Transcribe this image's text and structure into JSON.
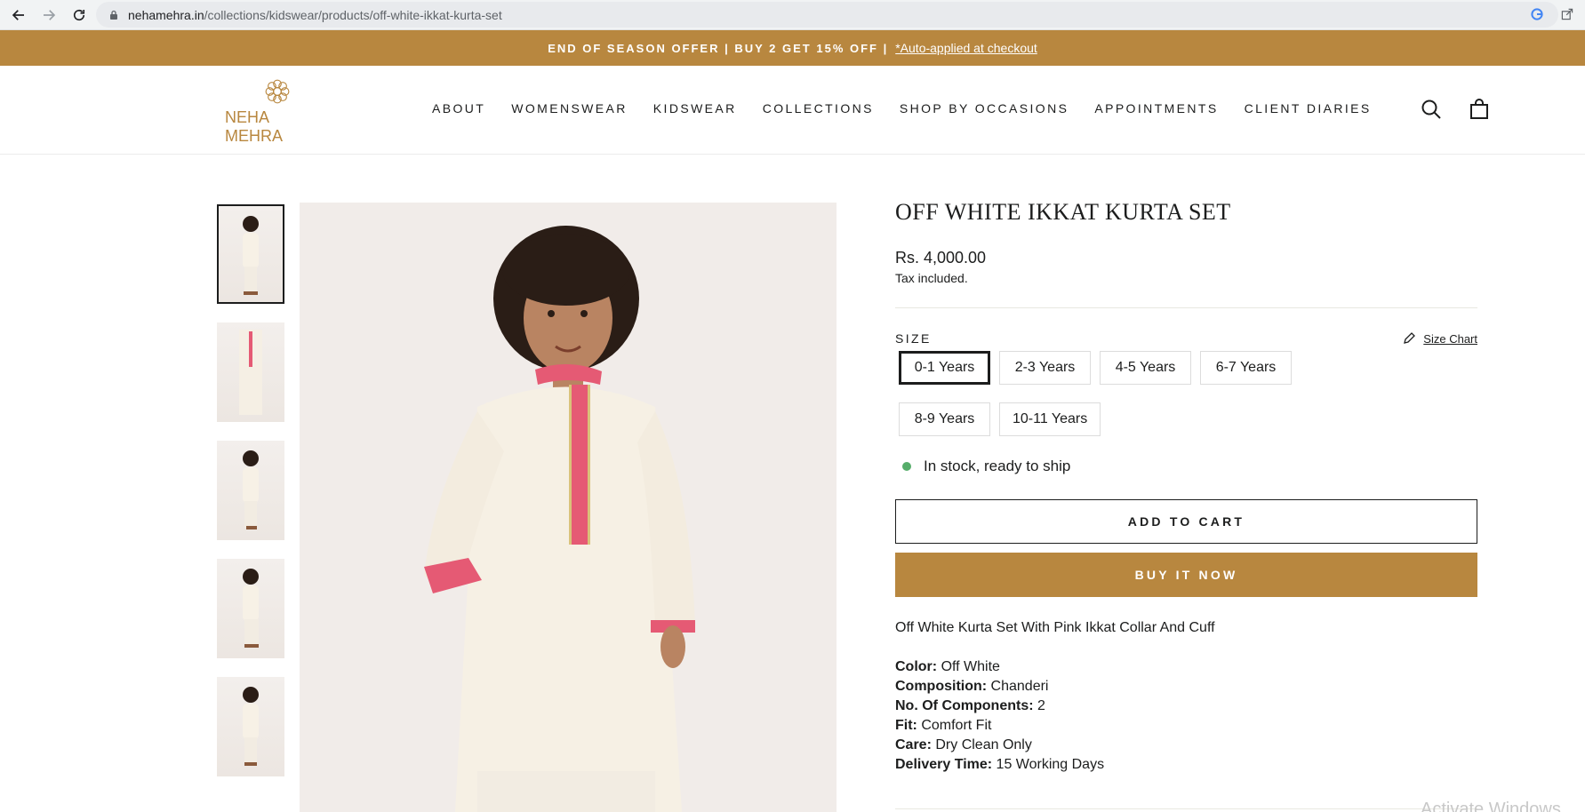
{
  "browser": {
    "url_domain": "nehamehra.in",
    "url_path": "/collections/kidswear/products/off-white-ikkat-kurta-set"
  },
  "announcement": {
    "text": "END OF SEASON OFFER | BUY 2 GET 15% OFF |",
    "link": "*Auto-applied at checkout"
  },
  "logo": {
    "text": "NEHA MEHRA"
  },
  "nav": {
    "items": [
      "ABOUT",
      "WOMENSWEAR",
      "KIDSWEAR",
      "COLLECTIONS",
      "SHOP BY OCCASIONS",
      "APPOINTMENTS",
      "CLIENT DIARIES"
    ]
  },
  "product": {
    "title": "OFF WHITE IKKAT KURTA SET",
    "price": "Rs. 4,000.00",
    "tax_note": "Tax included.",
    "size_label": "SIZE",
    "size_chart_label": "Size Chart",
    "sizes": [
      "0-1 Years",
      "2-3 Years",
      "4-5 Years",
      "6-7 Years",
      "8-9 Years",
      "10-11 Years"
    ],
    "selected_size": "0-1 Years",
    "stock": "In stock, ready to ship",
    "add_to_cart": "ADD TO CART",
    "buy_now": "BUY IT NOW",
    "description": "Off White Kurta Set With Pink Ikkat Collar And Cuff",
    "specs": [
      {
        "label": "Color:",
        "value": "Off White"
      },
      {
        "label": "Composition:",
        "value": "Chanderi"
      },
      {
        "label": "No. Of Components:",
        "value": "2"
      },
      {
        "label": "Fit:",
        "value": "Comfort Fit"
      },
      {
        "label": "Care:",
        "value": "Dry Clean Only"
      },
      {
        "label": "Delivery Time:",
        "value": "15 Working Days"
      }
    ]
  },
  "colors": {
    "brand": "#b8873f",
    "text": "#1c1d1d",
    "stock_dot": "#56ad6a"
  },
  "watermark": "Activate Windows"
}
